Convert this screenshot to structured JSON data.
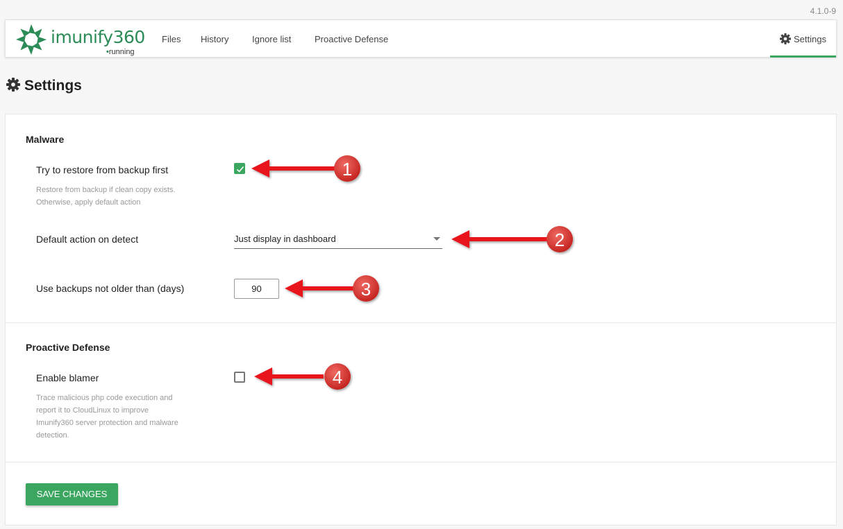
{
  "version": "4.1.0-9",
  "app": {
    "logo_text": "imunify360",
    "status": "running",
    "brand_color": "#2c8c57"
  },
  "nav": {
    "items": [
      {
        "label": "Files"
      },
      {
        "label": "History"
      },
      {
        "label": "Ignore list"
      },
      {
        "label": "Proactive Defense"
      }
    ],
    "settings_label": "Settings",
    "settings_icon": "gear-icon",
    "active_color": "#3aa65f"
  },
  "page": {
    "title": "Settings",
    "title_icon": "gear-icon"
  },
  "malware": {
    "title": "Malware",
    "restore": {
      "label": "Try to restore from backup first",
      "description_line1": "Restore from backup if clean copy exists.",
      "description_line2": "Otherwise, apply default action",
      "checked": true
    },
    "default_action": {
      "label": "Default action on detect",
      "value": "Just display in dashboard"
    },
    "backup_age": {
      "label": "Use backups not older than (days)",
      "value": "90"
    }
  },
  "proactive": {
    "title": "Proactive Defense",
    "blamer": {
      "label": "Enable blamer",
      "description_line1": "Trace malicious php code execution and",
      "description_line2": "report it to CloudLinux to improve",
      "description_line3": "Imunify360 server protection and malware",
      "description_line4": "detection.",
      "checked": false
    }
  },
  "save_label": "SAVE CHANGES",
  "annotations": {
    "callouts": [
      "1",
      "2",
      "3",
      "4"
    ],
    "arrow_color": "#e8141c",
    "badge_color": "#d8322e"
  }
}
